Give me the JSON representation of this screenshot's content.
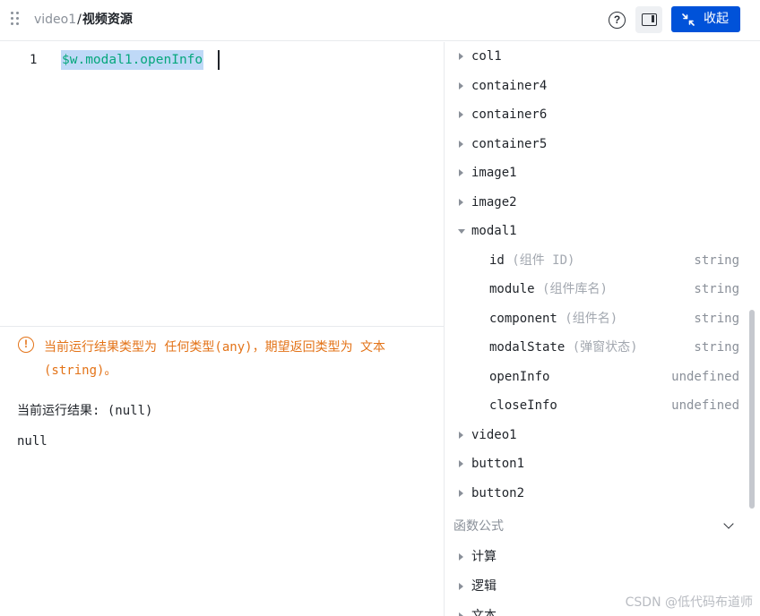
{
  "header": {
    "breadcrumb_parent": "video1",
    "breadcrumb_sep": "/",
    "breadcrumb_current": "视频资源",
    "help_icon": "question-circle-icon",
    "panel_icon": "panel-toggle-icon",
    "collapse_label": "收起",
    "collapse_icon": "shrink-arrows-icon"
  },
  "editor": {
    "line_number": "1",
    "code": "$w.modal1.openInfo"
  },
  "result": {
    "warning": "当前运行结果类型为 任何类型(any)，期望返回类型为 文本(string)。",
    "label": "当前运行结果: (null)",
    "value": "null"
  },
  "tree": {
    "nodes": [
      {
        "label": "col1",
        "expanded": false
      },
      {
        "label": "container4",
        "expanded": false
      },
      {
        "label": "container6",
        "expanded": false
      },
      {
        "label": "container5",
        "expanded": false
      },
      {
        "label": "image1",
        "expanded": false
      },
      {
        "label": "image2",
        "expanded": false
      },
      {
        "label": "modal1",
        "expanded": true
      }
    ],
    "modal1_props": [
      {
        "name": "id",
        "desc": "(组件 ID)",
        "type": "string"
      },
      {
        "name": "module",
        "desc": "(组件库名)",
        "type": "string"
      },
      {
        "name": "component",
        "desc": "(组件名)",
        "type": "string"
      },
      {
        "name": "modalState",
        "desc": "(弹窗状态)",
        "type": "string"
      },
      {
        "name": "openInfo",
        "desc": "",
        "type": "undefined"
      },
      {
        "name": "closeInfo",
        "desc": "",
        "type": "undefined"
      }
    ],
    "after_nodes": [
      {
        "label": "video1",
        "expanded": false
      },
      {
        "label": "button1",
        "expanded": false
      },
      {
        "label": "button2",
        "expanded": false
      }
    ]
  },
  "functions": {
    "title": "函数公式",
    "items": [
      {
        "label": "计算"
      },
      {
        "label": "逻辑"
      },
      {
        "label": "文本"
      }
    ]
  },
  "watermark": "CSDN @低代码布道师",
  "colors": {
    "primary": "#0052d9",
    "warning": "#e37318",
    "code": "#06a77d",
    "selection": "#bfd9f7"
  }
}
